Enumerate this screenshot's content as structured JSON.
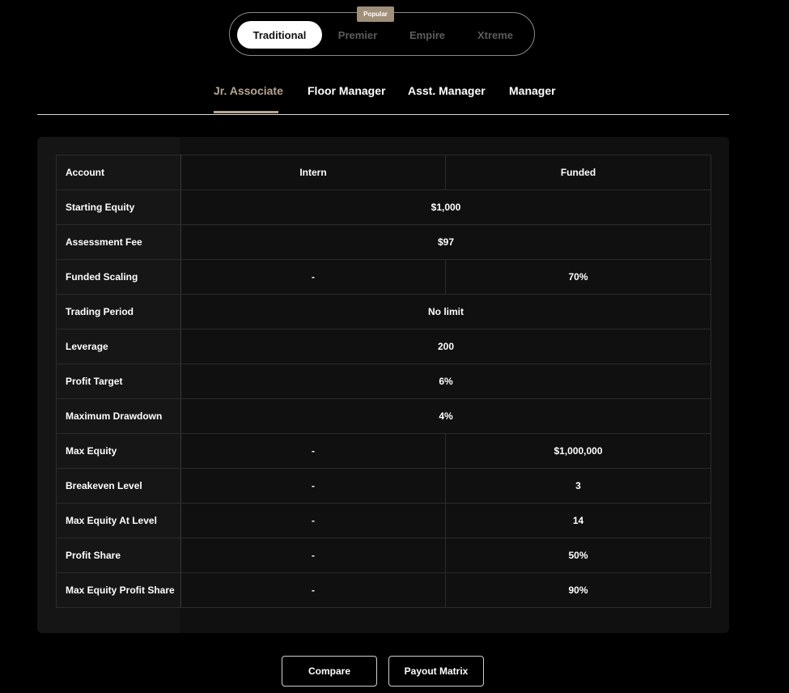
{
  "plans": {
    "options": [
      "Traditional",
      "Premier",
      "Empire",
      "Xtreme"
    ],
    "active": "Traditional",
    "badge": "Popular"
  },
  "tiers": {
    "tabs": [
      "Jr. Associate",
      "Floor Manager",
      "Asst. Manager",
      "Manager"
    ],
    "active": "Jr. Associate"
  },
  "table": {
    "header": {
      "label": "Account",
      "intern": "Intern",
      "funded": "Funded"
    },
    "rows": [
      {
        "label": "Starting Equity",
        "merged": true,
        "value": "$1,000"
      },
      {
        "label": "Assessment Fee",
        "merged": true,
        "value": "$97"
      },
      {
        "label": "Funded Scaling",
        "merged": false,
        "intern": "-",
        "funded": "70%"
      },
      {
        "label": "Trading Period",
        "merged": true,
        "value": "No limit"
      },
      {
        "label": "Leverage",
        "merged": true,
        "value": "200"
      },
      {
        "label": "Profit Target",
        "merged": true,
        "value": "6%"
      },
      {
        "label": "Maximum Drawdown",
        "merged": true,
        "value": "4%"
      },
      {
        "label": "Max Equity",
        "merged": false,
        "intern": "-",
        "funded": "$1,000,000"
      },
      {
        "label": "Breakeven Level",
        "merged": false,
        "intern": "-",
        "funded": "3"
      },
      {
        "label": "Max Equity At Level",
        "merged": false,
        "intern": "-",
        "funded": "14"
      },
      {
        "label": "Profit Share",
        "merged": false,
        "intern": "-",
        "funded": "50%"
      },
      {
        "label": "Max Equity Profit Share",
        "merged": false,
        "intern": "-",
        "funded": "90%"
      }
    ]
  },
  "actions": {
    "compare": "Compare",
    "payout_matrix": "Payout Matrix"
  },
  "colors": {
    "accent": "#b5a592",
    "badge": "#a08f7a",
    "background": "#000000",
    "card": "#101010"
  }
}
